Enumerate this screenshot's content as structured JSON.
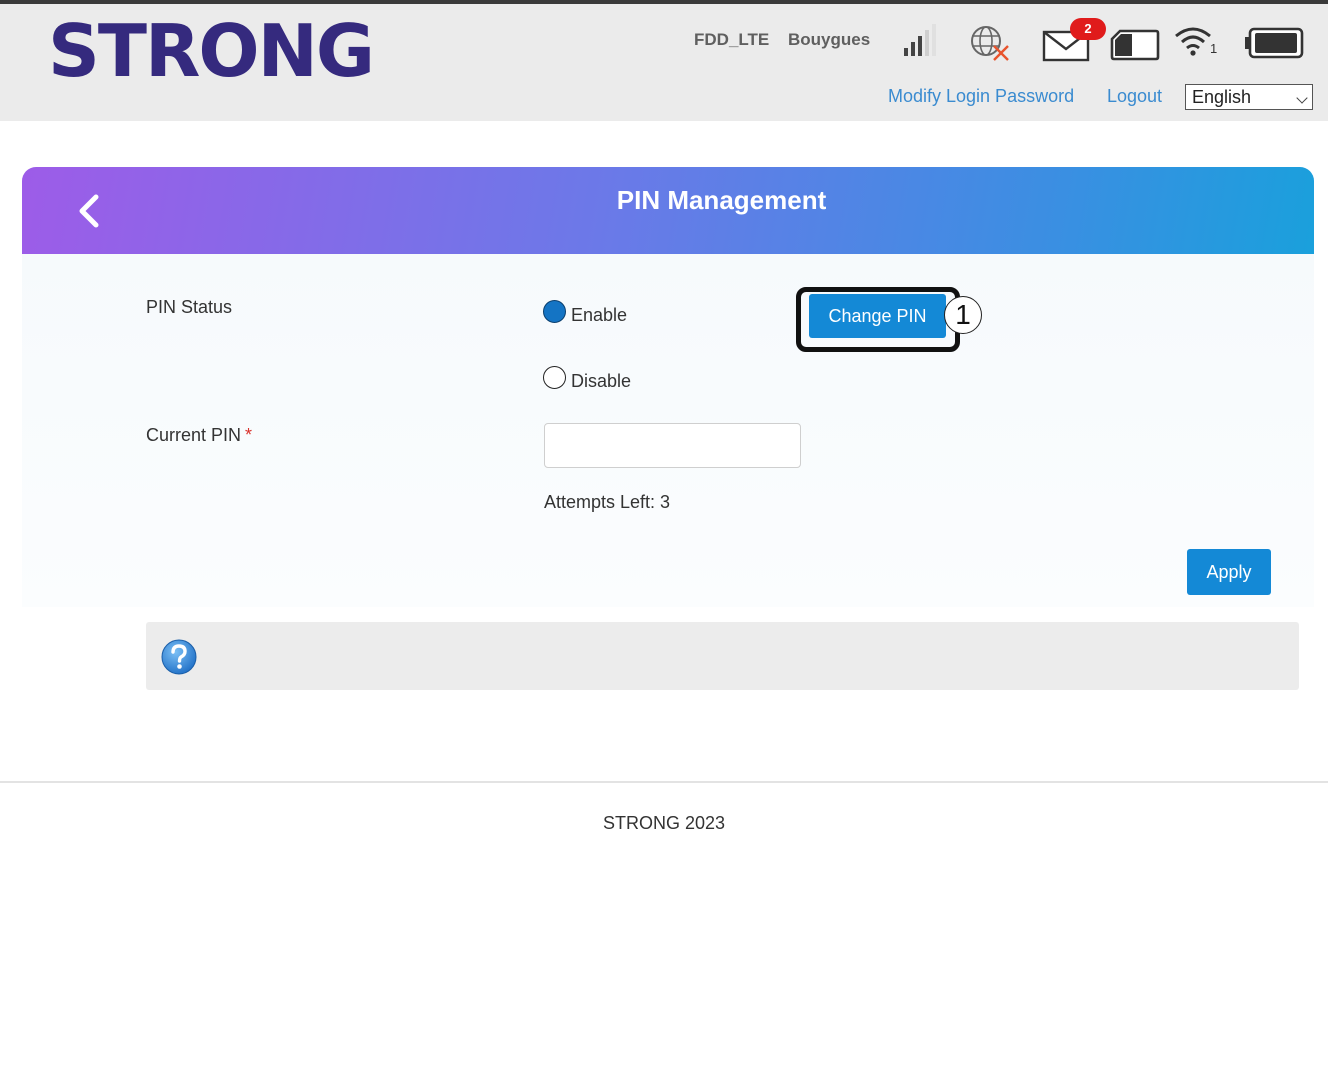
{
  "header": {
    "logo_text": "STRONG",
    "network_type": "FDD_LTE",
    "operator": "Bouygues",
    "message_count": "2",
    "wifi_clients": "1",
    "modify_password_label": "Modify Login Password",
    "logout_label": "Logout",
    "language_selected": "English",
    "icons": [
      "signal-icon",
      "globe-disconnected-icon",
      "mail-icon",
      "sim-card-icon",
      "wifi-icon",
      "battery-icon"
    ]
  },
  "card": {
    "title": "PIN Management",
    "back_icon": "chevron-left-icon",
    "pin_status_label": "PIN Status",
    "enable_label": "Enable",
    "disable_label": "Disable",
    "pin_status_value": "Enable",
    "change_pin_label": "Change PIN",
    "callout_number": "1",
    "current_pin_label": "Current PIN",
    "required_mark": "*",
    "current_pin_value": "",
    "attempts_text": "Attempts Left: 3",
    "apply_label": "Apply"
  },
  "help": {
    "icon": "question-icon"
  },
  "footer": {
    "text": "STRONG 2023"
  },
  "colors": {
    "accent_blue": "#1489d6",
    "link_blue": "#3a8bd0",
    "header_gradient_start": "#9d5ce8",
    "header_gradient_end": "#1aa0dc",
    "badge_red": "#e01b1b",
    "required_red": "#d9322b"
  }
}
